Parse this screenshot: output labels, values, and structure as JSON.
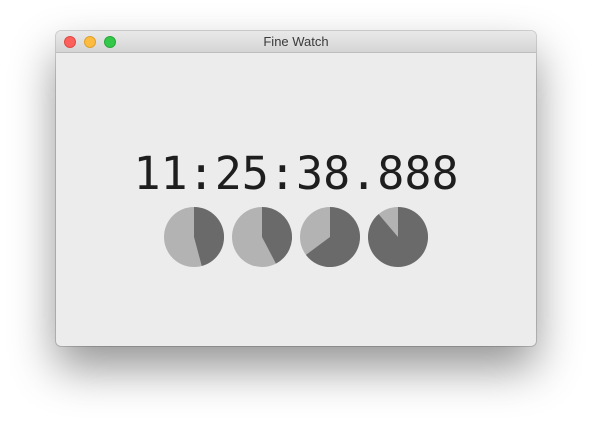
{
  "window": {
    "title": "Fine Watch"
  },
  "clock": {
    "time": "11:25:38.888"
  },
  "dials": [
    {
      "label": "hours-dial",
      "fraction": 0.4583
    },
    {
      "label": "minutes-dial",
      "fraction": 0.4231
    },
    {
      "label": "seconds-dial",
      "fraction": 0.6481
    },
    {
      "label": "milliseconds-dial",
      "fraction": 0.888
    }
  ],
  "colors": {
    "dial_filled": "#6a6a6a",
    "dial_remaining": "#b3b3b3"
  },
  "icons": {
    "close": "close-button-icon",
    "minimize": "minimize-button-icon",
    "zoom": "zoom-button-icon"
  }
}
